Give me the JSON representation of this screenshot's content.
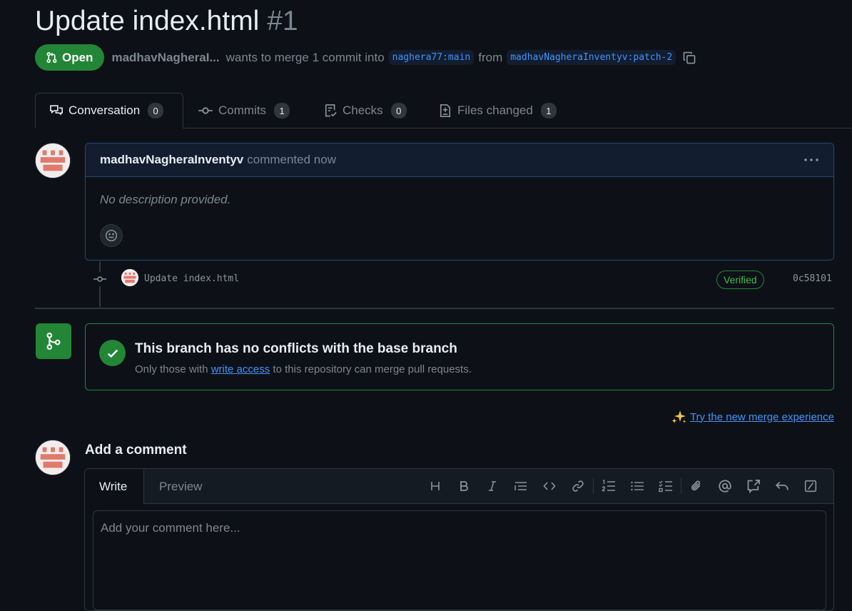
{
  "pr": {
    "title": "Update index.html",
    "number": "#1",
    "status": "Open",
    "author_truncated": "madhavNagheraI...",
    "merge_text": "wants to merge 1 commit into",
    "base_branch": "naghera77:main",
    "from_text": "from",
    "head_branch": "madhavNagheraInventyv:patch-2"
  },
  "tabs": [
    {
      "label": "Conversation",
      "count": "0",
      "icon": "comment-discussion-icon"
    },
    {
      "label": "Commits",
      "count": "1",
      "icon": "git-commit-icon"
    },
    {
      "label": "Checks",
      "count": "0",
      "icon": "checklist-icon"
    },
    {
      "label": "Files changed",
      "count": "1",
      "icon": "file-diff-icon"
    }
  ],
  "comment": {
    "author": "madhavNagheraInventyv",
    "time": "commented now",
    "body": "No description provided.",
    "menu_icon": "kebab-horizontal-icon"
  },
  "commit": {
    "message": "Update index.html",
    "badge": "Verified",
    "sha": "0c58101"
  },
  "merge": {
    "title": "This branch has no conflicts with the base branch",
    "sub_before": "Only those with",
    "sub_link": "write access",
    "sub_after": "to this repository can merge pull requests."
  },
  "new_merge": {
    "label": "Try the new merge experience",
    "icon": "sparkles-icon"
  },
  "add_comment": {
    "heading": "Add a comment",
    "tab_write": "Write",
    "tab_preview": "Preview",
    "placeholder": "Add your comment here..."
  },
  "toolbar_icons": [
    "heading-icon",
    "bold-icon",
    "italic-icon",
    "quote-icon",
    "code-icon",
    "link-icon",
    "ordered-list-icon",
    "unordered-list-icon",
    "task-list-icon",
    "attach-icon",
    "mention-icon",
    "cross-reference-icon",
    "reply-icon",
    "slash-command-icon"
  ],
  "colors": {
    "background": "#0d1117",
    "open_green": "#238636",
    "link_blue": "#4493f8",
    "muted": "#7d8590",
    "border": "#30363d"
  }
}
